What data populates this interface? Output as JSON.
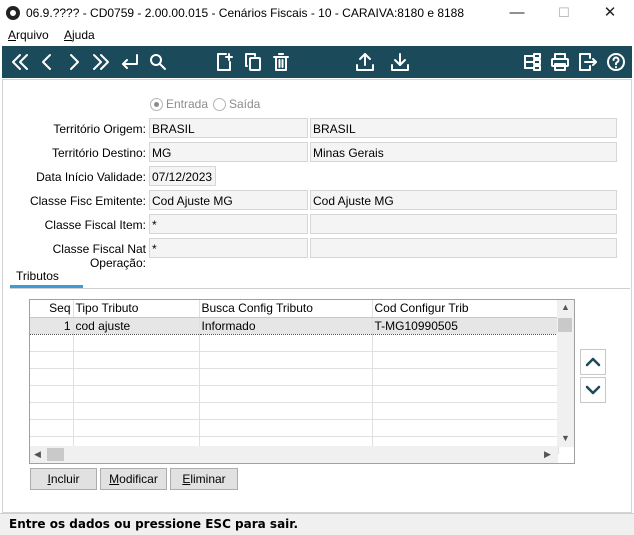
{
  "window": {
    "title": "06.9.???? - CD0759 - 2.00.00.015 - Cenários Fiscais - 10 - CARAIVA:8180 e 8188",
    "minimize": "—",
    "maximize": "☐",
    "close": "✕"
  },
  "menu": {
    "arquivo_first": "A",
    "arquivo_rest": "rquivo",
    "ajuda_first": "A",
    "ajuda_rest": "juda"
  },
  "toolbar": {
    "icons": [
      "first-icon",
      "previous-icon",
      "next-icon",
      "last-icon",
      "enter-icon",
      "search-icon",
      "new-document-icon",
      "copy-icon",
      "delete-icon",
      "upload-icon",
      "download-icon",
      "structure-icon",
      "print-icon",
      "exit-icon",
      "help-icon"
    ]
  },
  "direction": {
    "entrada": "Entrada",
    "saida": "Saída",
    "selected": "Entrada"
  },
  "form": {
    "territorio_origem": {
      "label": "Território Origem:",
      "code": "BRASIL",
      "desc": "BRASIL"
    },
    "territorio_destino": {
      "label": "Território Destino:",
      "code": "MG",
      "desc": "Minas Gerais"
    },
    "data_inicio": {
      "label": "Data Início Validade:",
      "value": "07/12/2023"
    },
    "classe_emitente": {
      "label": "Classe Fisc Emitente:",
      "code": "Cod Ajuste MG",
      "desc": "Cod Ajuste MG"
    },
    "classe_item": {
      "label": "Classe Fiscal Item:",
      "code": "*",
      "desc": ""
    },
    "classe_nat": {
      "label": "Classe Fiscal Nat Operação:",
      "code": "*",
      "desc": ""
    }
  },
  "tabs": {
    "tributos": "Tributos"
  },
  "grid": {
    "headers": [
      "Seq",
      "Tipo Tributo",
      "Busca Config Tributo",
      "Cod Configur Trib"
    ],
    "rows": [
      {
        "seq": "1",
        "tipo": "cod ajuste",
        "busca": "Informado",
        "cod": "T-MG10990505"
      }
    ]
  },
  "buttons": {
    "incluir_first": "I",
    "incluir_rest": "ncluir",
    "modificar_first": "M",
    "modificar_rest": "odificar",
    "eliminar_first": "E",
    "eliminar_rest": "liminar"
  },
  "status": "Entre os dados ou pressione ESC para sair."
}
